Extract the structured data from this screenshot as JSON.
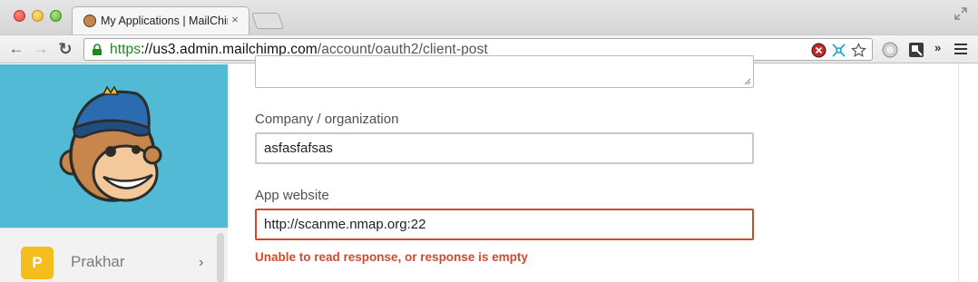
{
  "browser": {
    "tab": {
      "title": "My Applications | MailChim",
      "close_glyph": "×"
    },
    "nav": {
      "back_glyph": "←",
      "forward_glyph": "→",
      "reload_glyph": "↻"
    },
    "address": {
      "scheme": "https",
      "scheme_sep": "://",
      "host": "us3.admin.mailchimp.com",
      "path": "/account/oauth2/client-post"
    },
    "overflow_glyph": "»",
    "icons": [
      "lock-icon",
      "block-icon",
      "network-icon",
      "star-icon",
      "globe-icon",
      "extension-icon",
      "menu-icon"
    ]
  },
  "sidebar": {
    "user": {
      "initial": "P",
      "name": "Prakhar",
      "chevron": "›",
      "avatar_color": "#f5be1c"
    },
    "brand_color": "#52bad5"
  },
  "form": {
    "company": {
      "label": "Company / organization",
      "value": "asfasfafsas"
    },
    "website": {
      "label": "App website",
      "value": "http://scanme.nmap.org:22",
      "error": "Unable to read response, or response is empty"
    }
  },
  "colors": {
    "error": "#d24a2d",
    "url_scheme": "#1a8a1a"
  }
}
